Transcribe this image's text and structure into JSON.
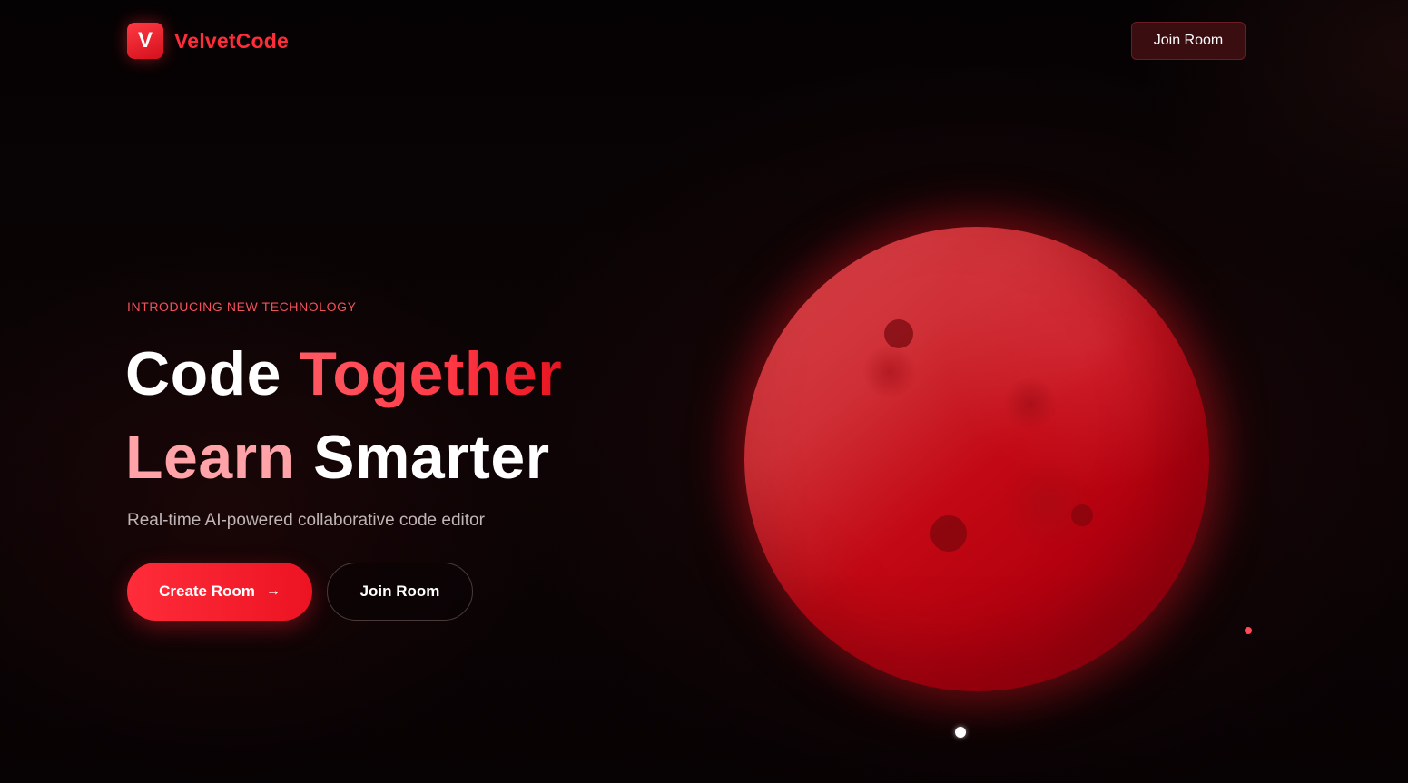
{
  "brand": {
    "logo_letter": "V",
    "name": "VelvetCode",
    "accent_color": "#ff2d3a"
  },
  "header": {
    "join_label": "Join Room"
  },
  "hero": {
    "eyebrow": "INTRODUCING NEW TECHNOLOGY",
    "headline": {
      "line1_white": "Code",
      "line1_red": "Together",
      "line2_pink": "Learn",
      "line2_white": "Smarter"
    },
    "subtitle": "Real-time AI-powered collaborative code editor",
    "create_label": "Create Room",
    "create_icon": "arrow-right-icon",
    "join_label": "Join Room"
  },
  "colors": {
    "background": "#040203",
    "primary": "#ff2c3a",
    "highlight_pink": "#ffa3a8",
    "planet": "#c20814"
  }
}
